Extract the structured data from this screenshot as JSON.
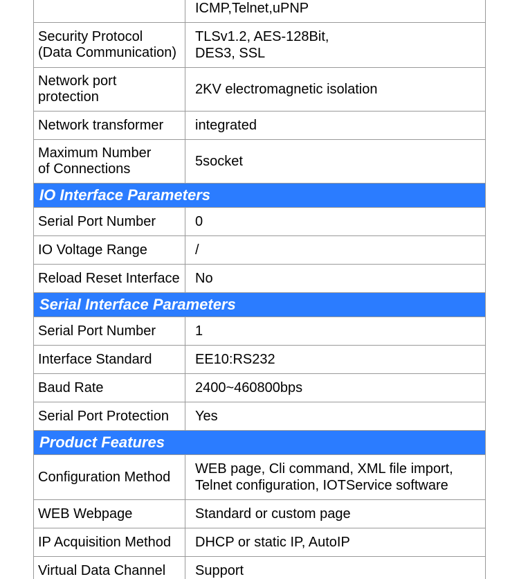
{
  "sections": [
    {
      "rows": [
        {
          "label": "",
          "value": "ICMP,Telnet,uPNP",
          "partialTop": true
        },
        {
          "label": "Security Protocol\n(Data Communication)",
          "value": "TLSv1.2, AES-128Bit,\nDES3, SSL"
        },
        {
          "label": "Network port\nprotection",
          "value": "2KV electromagnetic isolation"
        },
        {
          "label": "Network transformer",
          "value": "integrated"
        },
        {
          "label": "Maximum Number\nof Connections",
          "value": "5socket"
        }
      ]
    },
    {
      "header": "IO Interface Parameters",
      "rows": [
        {
          "label": "Serial Port Number",
          "value": "0"
        },
        {
          "label": "IO Voltage Range",
          "value": "/"
        },
        {
          "label": "Reload Reset Interface",
          "value": "No"
        }
      ]
    },
    {
      "header": "Serial Interface Parameters",
      "rows": [
        {
          "label": "Serial Port Number",
          "value": "1"
        },
        {
          "label": "Interface Standard",
          "value": "EE10:RS232"
        },
        {
          "label": "Baud Rate",
          "value": "2400~460800bps"
        },
        {
          "label": "Serial Port Protection",
          "value": "Yes"
        }
      ]
    },
    {
      "header": "Product Features",
      "rows": [
        {
          "label": "Configuration Method",
          "value": "WEB page, Cli command, XML file import, Telnet configuration, IOTService software"
        },
        {
          "label": "WEB Webpage",
          "value": "Standard or custom page"
        },
        {
          "label": "IP Acquisition Method",
          "value": "DHCP or static IP, AutoIP"
        },
        {
          "label": "Virtual Data Channel",
          "value": "Support",
          "partialBottom": true
        }
      ]
    }
  ]
}
